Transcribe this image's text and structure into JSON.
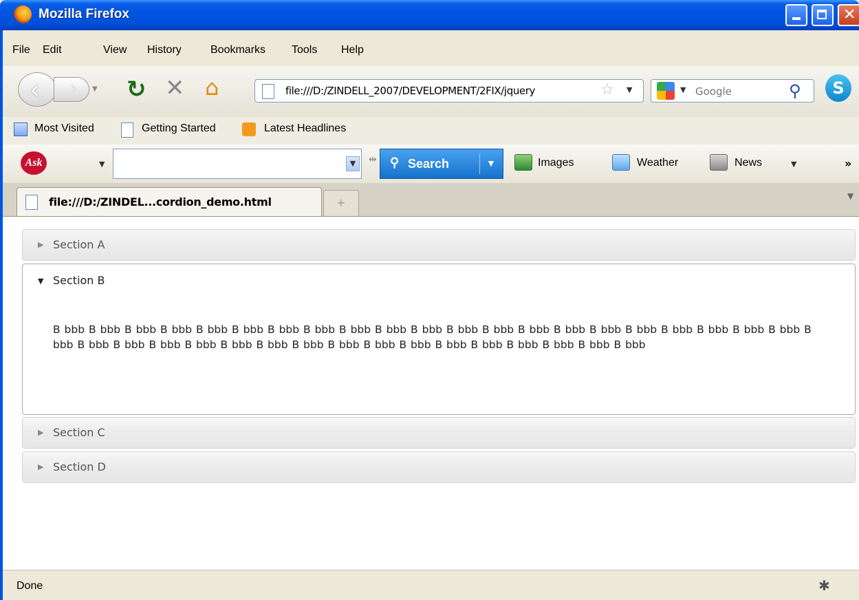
{
  "window": {
    "title": "Mozilla Firefox"
  },
  "menu": [
    "File",
    "Edit",
    "View",
    "History",
    "Bookmarks",
    "Tools",
    "Help"
  ],
  "nav": {
    "url": "file:///D:/ZINDELL_2007/DEVELOPMENT/2FIX/jquery",
    "search_placeholder": "Google"
  },
  "bookmarks": [
    "Most Visited",
    "Getting Started",
    "Latest Headlines"
  ],
  "ask_toolbar": {
    "search_label": "Search",
    "items": [
      "Images",
      "Weather",
      "News"
    ],
    "chevron": "»"
  },
  "tab": {
    "title": "file:///D:/ZINDEL...cordion_demo.html",
    "new_tab": "+"
  },
  "accordion": {
    "sections": [
      {
        "label": "Section A",
        "open": false
      },
      {
        "label": "Section B",
        "open": true,
        "body": "B bbb B bbb B bbb B bbb B bbb B bbb B bbb B bbb B bbb B bbb B bbb B bbb B bbb B bbb B bbb B bbb B bbb B bbb B bbb B bbb B bbb B bbb B bbb B bbb B bbb B bbb B bbb B bbb B bbb B bbb B bbb B bbb B bbb B bbb B bbb B bbb B bbb B bbb"
      },
      {
        "label": "Section C",
        "open": false
      },
      {
        "label": "Section D",
        "open": false
      }
    ]
  },
  "status": {
    "text": "Done"
  }
}
